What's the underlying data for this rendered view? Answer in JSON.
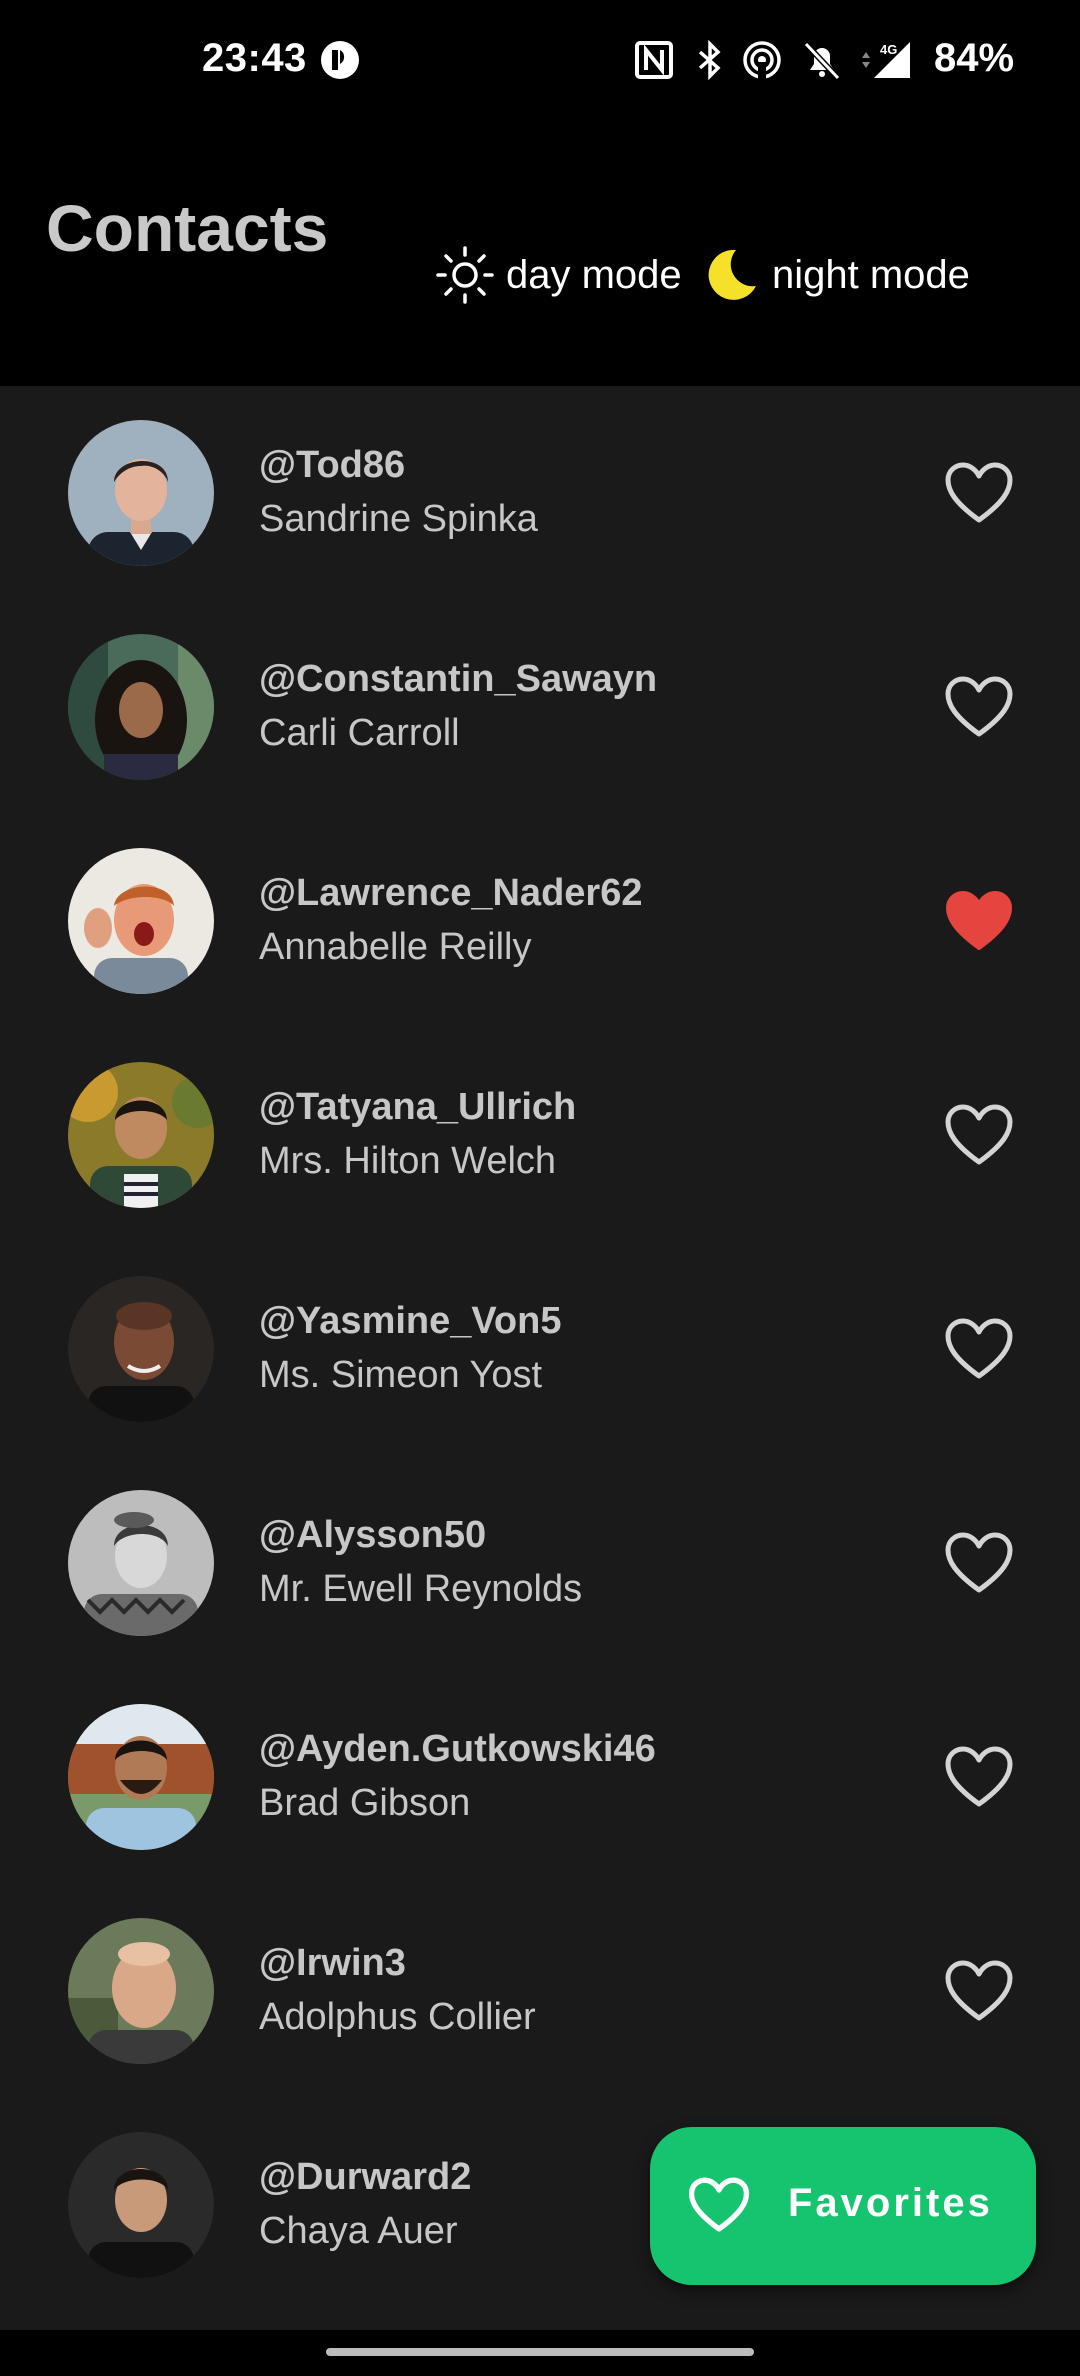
{
  "status_bar": {
    "time": "23:43",
    "battery": "84%",
    "network": "4G",
    "icons": [
      "app-notification-icon",
      "nfc-icon",
      "bluetooth-icon",
      "hotspot-icon",
      "silent-bell-icon",
      "signal-icon"
    ]
  },
  "header": {
    "title": "Contacts",
    "day_mode_label": "day mode",
    "night_mode_label": "night mode",
    "day_mode_icon": "sun-icon",
    "night_mode_icon": "moon-icon"
  },
  "contacts": [
    {
      "handle": "@Tod86",
      "name": "Sandrine Spinka",
      "favorite": false
    },
    {
      "handle": "@Constantin_Sawayn",
      "name": "Carli Carroll",
      "favorite": false
    },
    {
      "handle": "@Lawrence_Nader62",
      "name": "Annabelle Reilly",
      "favorite": true
    },
    {
      "handle": "@Tatyana_Ullrich",
      "name": "Mrs. Hilton Welch",
      "favorite": false
    },
    {
      "handle": "@Yasmine_Von5",
      "name": "Ms. Simeon Yost",
      "favorite": false
    },
    {
      "handle": "@Alysson50",
      "name": "Mr. Ewell Reynolds",
      "favorite": false
    },
    {
      "handle": "@Ayden.Gutkowski46",
      "name": "Brad Gibson",
      "favorite": false
    },
    {
      "handle": "@Irwin3",
      "name": "Adolphus Collier",
      "favorite": false
    },
    {
      "handle": "@Durward2",
      "name": "Chaya Auer",
      "favorite": false
    }
  ],
  "fab": {
    "label": "Favorites",
    "icon": "heart-outline-icon"
  },
  "colors": {
    "background": "#000000",
    "list_background": "#1a1a1b",
    "text": "#c7c7c7",
    "favorite_active": "#e5443f",
    "fab": "#16c46f",
    "moon": "#f5e12a"
  }
}
